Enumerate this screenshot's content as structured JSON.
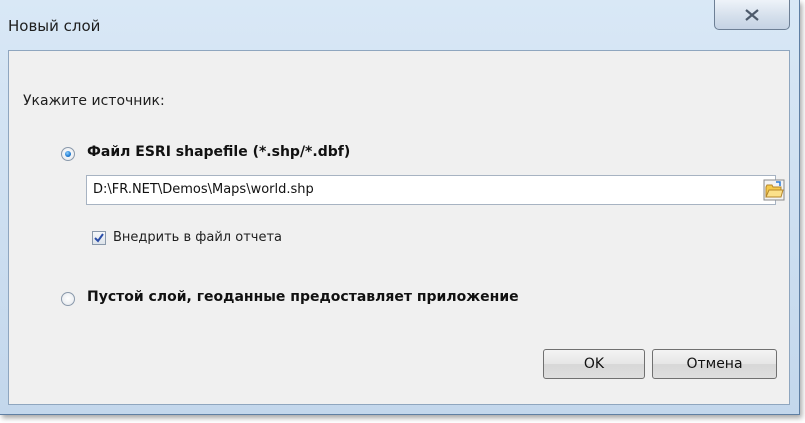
{
  "window": {
    "title": "Новый слой"
  },
  "dialog": {
    "source_label": "Укажите источник:",
    "options": [
      {
        "label": "Файл ESRI shapefile (*.shp/*.dbf)",
        "selected": true
      },
      {
        "label": "Пустой слой, геоданные предоставляет приложение",
        "selected": false
      }
    ],
    "file_path": "D:\\FR.NET\\Demos\\Maps\\world.shp",
    "embed_label": "Внедрить в файл отчета",
    "embed_checked": true
  },
  "buttons": {
    "ok": "OK",
    "cancel": "Отмена"
  },
  "icons": {
    "close": "close-icon",
    "browse": "folder-open-icon"
  }
}
